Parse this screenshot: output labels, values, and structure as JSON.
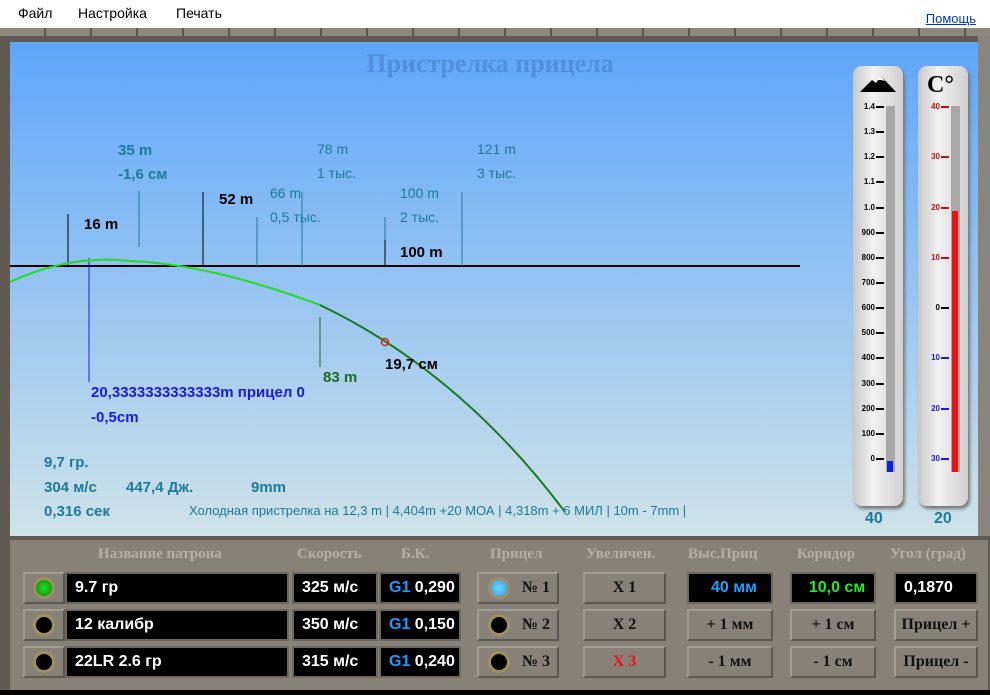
{
  "menu": {
    "file": "Файл",
    "settings": "Настройка",
    "print": "Печать",
    "help": "Помощь"
  },
  "chart": {
    "title": "Пристрелка прицела",
    "marks": {
      "m16": "16 m",
      "m35": "35 m",
      "m35_drop": "-1,6 см",
      "m52": "52 m",
      "m66": "66 m",
      "m66_sub": "0,5 тыс.",
      "m78": "78 m",
      "m78_sub": "1 тыс.",
      "m100a": "100 m",
      "m100a_sub": "2 тыс.",
      "m121": "121 m",
      "m121_sub": "3 тыс.",
      "m100": "100 m",
      "m83": "83 m",
      "drop": "19,7 см"
    },
    "zero": {
      "dist": "20,3333333333333m  прицел 0",
      "offset": "-0,5cm"
    },
    "info": {
      "weight": "9,7 гр.",
      "speed": "304 м/с",
      "energy": "447,4 Дж.",
      "caliber": "9mm",
      "time": "0,316 сек",
      "summary": "Холодная пристрелка на 12,3 m | 4,404m +20 МОА | 4,318m + 6 МИЛ | 10m  - 7mm |"
    }
  },
  "altimeter": {
    "ticks": [
      "1.4",
      "1.3",
      "1.2",
      "1.1",
      "1.0",
      "900",
      "800",
      "700",
      "600",
      "500",
      "400",
      "300",
      "200",
      "100",
      "0"
    ],
    "value": "40",
    "fill_fraction": 0.03
  },
  "thermometer": {
    "unit": "C°",
    "ticks": [
      "40",
      "30",
      "20",
      "10",
      "0",
      "10",
      "20",
      "30"
    ],
    "value": "20",
    "fill_fraction": 0.714
  },
  "panel": {
    "headers": {
      "name": "Название патрона",
      "speed": "Скорость",
      "bc": "Б.К.",
      "scope": "Прицел",
      "zoom": "Увеличен.",
      "height": "Выс.Приц",
      "corridor": "Коридор",
      "angle": "Угол (град)"
    },
    "cartridges": [
      {
        "name": "9.7 гр",
        "speed": "325 м/с",
        "model": "G1",
        "bc": "0,290",
        "selected": true
      },
      {
        "name": "12 калибр",
        "speed": "350 м/с",
        "model": "G1",
        "bc": "0,150",
        "selected": false
      },
      {
        "name": "22LR 2.6 гр",
        "speed": "315 м/с",
        "model": "G1",
        "bc": "0,240",
        "selected": false
      }
    ],
    "scopes": [
      {
        "label": "№ 1",
        "selected": true
      },
      {
        "label": "№ 2",
        "selected": false
      },
      {
        "label": "№ 3",
        "selected": false
      }
    ],
    "zooms": [
      "X 1",
      "X 2",
      "X 3"
    ],
    "height": {
      "value": "40 мм",
      "plus": "+ 1 мм",
      "minus": "- 1 мм"
    },
    "corridor": {
      "value": "10,0 см",
      "plus": "+ 1 см",
      "minus": "- 1 см"
    },
    "angle": {
      "value": "0,1870",
      "plus": "Прицел +",
      "minus": "Прицел -"
    },
    "colors": {
      "led_on": "#22dd22",
      "scope_on": "#1aa0f0",
      "height": "#1aa0ff",
      "corridor": "#22ee22",
      "zoom_active": "#ee1111"
    }
  }
}
